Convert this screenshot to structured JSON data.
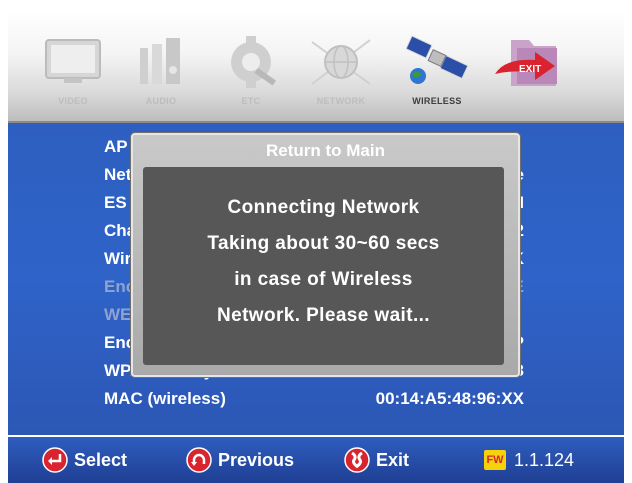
{
  "menu": {
    "items": [
      {
        "label": "VIDEO"
      },
      {
        "label": "AUDIO"
      },
      {
        "label": "ETC"
      },
      {
        "label": "NETWORK"
      },
      {
        "label": "WIRELESS"
      },
      {
        "label": "EXIT"
      }
    ],
    "active_index": 4
  },
  "settings": [
    {
      "label": "AP",
      "value": ""
    },
    {
      "label": "Net",
      "value": "e"
    },
    {
      "label": "ES",
      "value": "M"
    },
    {
      "label": "Cha",
      "value": "2"
    },
    {
      "label": "Wir",
      "value": "K"
    },
    {
      "label": "Enc",
      "value": "E"
    },
    {
      "label": "WE",
      "value": ""
    },
    {
      "label": "Enc",
      "value": "P"
    },
    {
      "label": "WPAPSK Key",
      "value": "f345dxf3"
    },
    {
      "label": "MAC (wireless)",
      "value": "00:14:A5:48:96:XX"
    }
  ],
  "dialog": {
    "title": "Return to Main",
    "lines": [
      "Connecting Network",
      "Taking about 30~60 secs",
      "in case of Wireless",
      "Network. Please wait..."
    ]
  },
  "bottom": {
    "select": "Select",
    "previous": "Previous",
    "exit": "Exit",
    "fw_badge": "FW",
    "version": "1.1.124"
  },
  "colors": {
    "panel_blue": "#2f63c8",
    "dialog_body": "#575757",
    "button_red": "#d9232e",
    "fw_yellow": "#f5d20a"
  }
}
